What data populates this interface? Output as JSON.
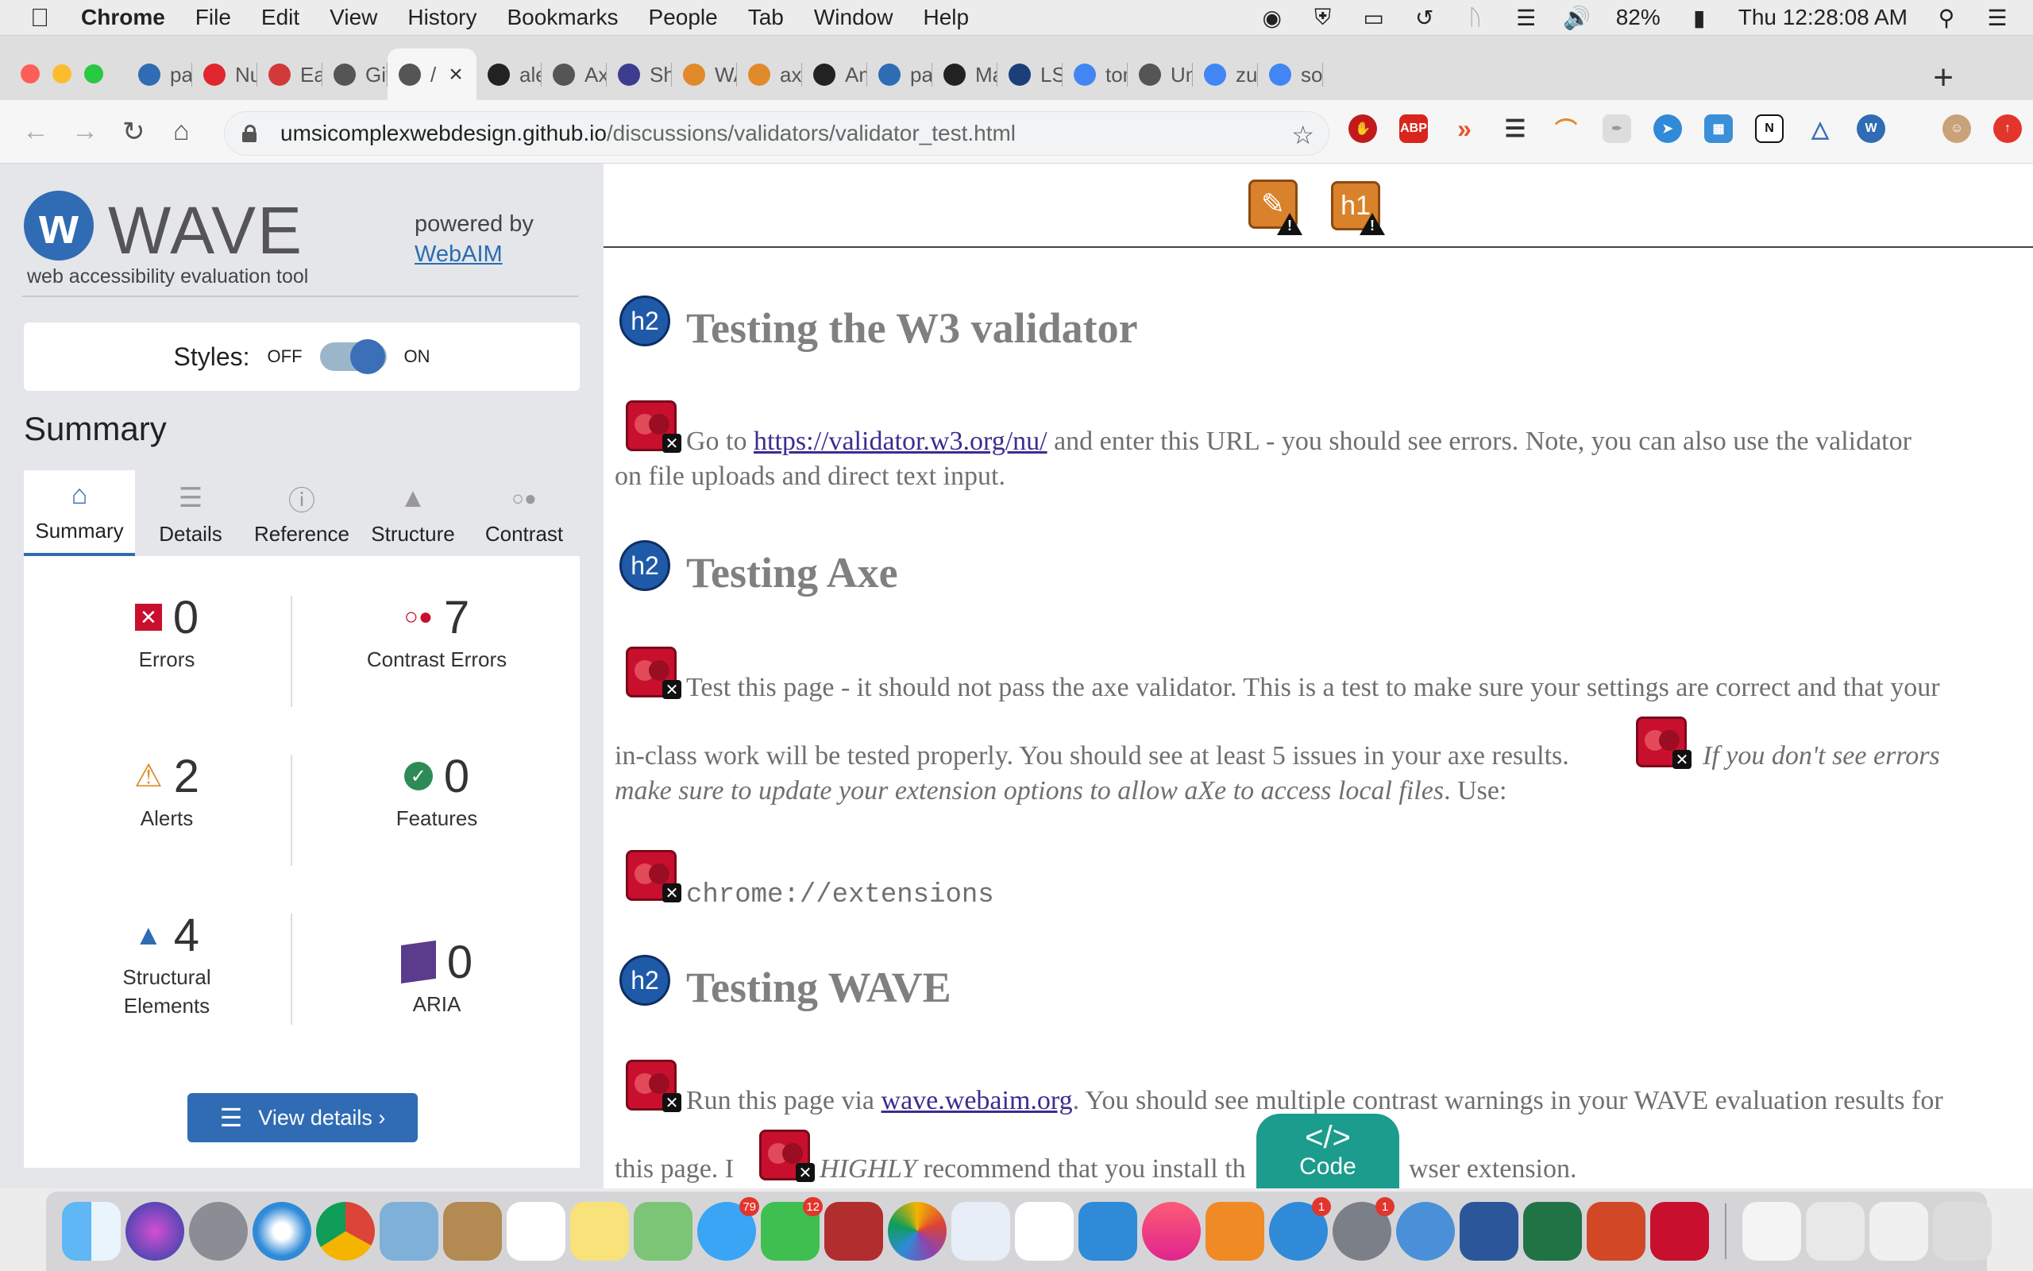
{
  "menubar": {
    "app": "Chrome",
    "items": [
      "File",
      "Edit",
      "View",
      "History",
      "Bookmarks",
      "People",
      "Tab",
      "Window",
      "Help"
    ],
    "battery": "82%",
    "clock": "Thu 12:28:08 AM"
  },
  "tabs": [
    {
      "label": "pan",
      "color": "#2f6cb4"
    },
    {
      "label": "Nun",
      "color": "#e0262f"
    },
    {
      "label": "Eas",
      "color": "#d23a3a"
    },
    {
      "label": "Gith",
      "color": "#555555"
    },
    {
      "label": "/",
      "color": "#555555",
      "active": true
    },
    {
      "label": "alex",
      "color": "#222222"
    },
    {
      "label": "Axe",
      "color": "#555555"
    },
    {
      "label": "Sho",
      "color": "#3d3d8f"
    },
    {
      "label": "WA\\",
      "color": "#e08a2c"
    },
    {
      "label": "axe",
      "color": "#e08a2c"
    },
    {
      "label": "Ama",
      "color": "#222222"
    },
    {
      "label": "pan",
      "color": "#2f6cb4"
    },
    {
      "label": "Mar",
      "color": "#222222"
    },
    {
      "label": "LSA",
      "color": "#1c3f7a"
    },
    {
      "label": "tom",
      "color": "#4285f4"
    },
    {
      "label": "Univ",
      "color": "#555555"
    },
    {
      "label": "zum",
      "color": "#4285f4"
    },
    {
      "label": "soft",
      "color": "#4285f4"
    }
  ],
  "toolbar": {
    "url_domain": "umsicomplexwebdesign.github.io",
    "url_path": "/discussions/validators/validator_test.html"
  },
  "wave": {
    "title": "WAVE",
    "subtitle": "web accessibility evaluation tool",
    "powered_by": "powered by",
    "powered_link": "WebAIM",
    "styles_label": "Styles:",
    "off": "OFF",
    "on": "ON",
    "summary_heading": "Summary",
    "tabs": [
      "Summary",
      "Details",
      "Reference",
      "Structure",
      "Contrast"
    ],
    "stats": {
      "errors": {
        "value": "0",
        "label": "Errors"
      },
      "contrast": {
        "value": "7",
        "label": "Contrast Errors"
      },
      "alerts": {
        "value": "2",
        "label": "Alerts"
      },
      "features": {
        "value": "0",
        "label": "Features"
      },
      "structural": {
        "value": "4",
        "label": "Structural Elements"
      },
      "aria": {
        "value": "0",
        "label": "ARIA"
      }
    },
    "view_details": "View details ›"
  },
  "page": {
    "h1_badge": "h1",
    "h2_badge": "h2",
    "heading1": "Testing the W3 validator",
    "p1_pre": "Go to ",
    "p1_link": "https://validator.w3.org/nu/",
    "p1_post": " and enter this URL - you should see errors. Note, you can also use the validator",
    "p1_line2": "on file uploads and direct text input.",
    "heading2": "Testing Axe",
    "p2_line1": "Test this page - it should not pass the axe validator. This is a test to make sure your settings are correct and that your",
    "p2_line2": "in-class work will be tested properly. You should see at least 5 issues in your axe results.",
    "p2_em1": "If you don't see errors",
    "p2_em2": "make sure to update your extension options to allow aXe to access local files",
    "p2_end": ". Use:",
    "code": "chrome://extensions",
    "heading3": "Testing WAVE",
    "p3_pre": "Run this page via ",
    "p3_link": "wave.webaim.org",
    "p3_post": ". You should see multiple contrast warnings in your WAVE evaluation results for",
    "p3_line2_pre": "this page. I",
    "p3_em": "HIGHLY",
    "p3_line2_post": " recommend that you install th",
    "p3_line2_tail": "wser extension.",
    "code_button": "Code"
  },
  "dock": {
    "badges": {
      "messages": "79",
      "facetime": "12",
      "appstore": "1",
      "settings": "1"
    }
  }
}
